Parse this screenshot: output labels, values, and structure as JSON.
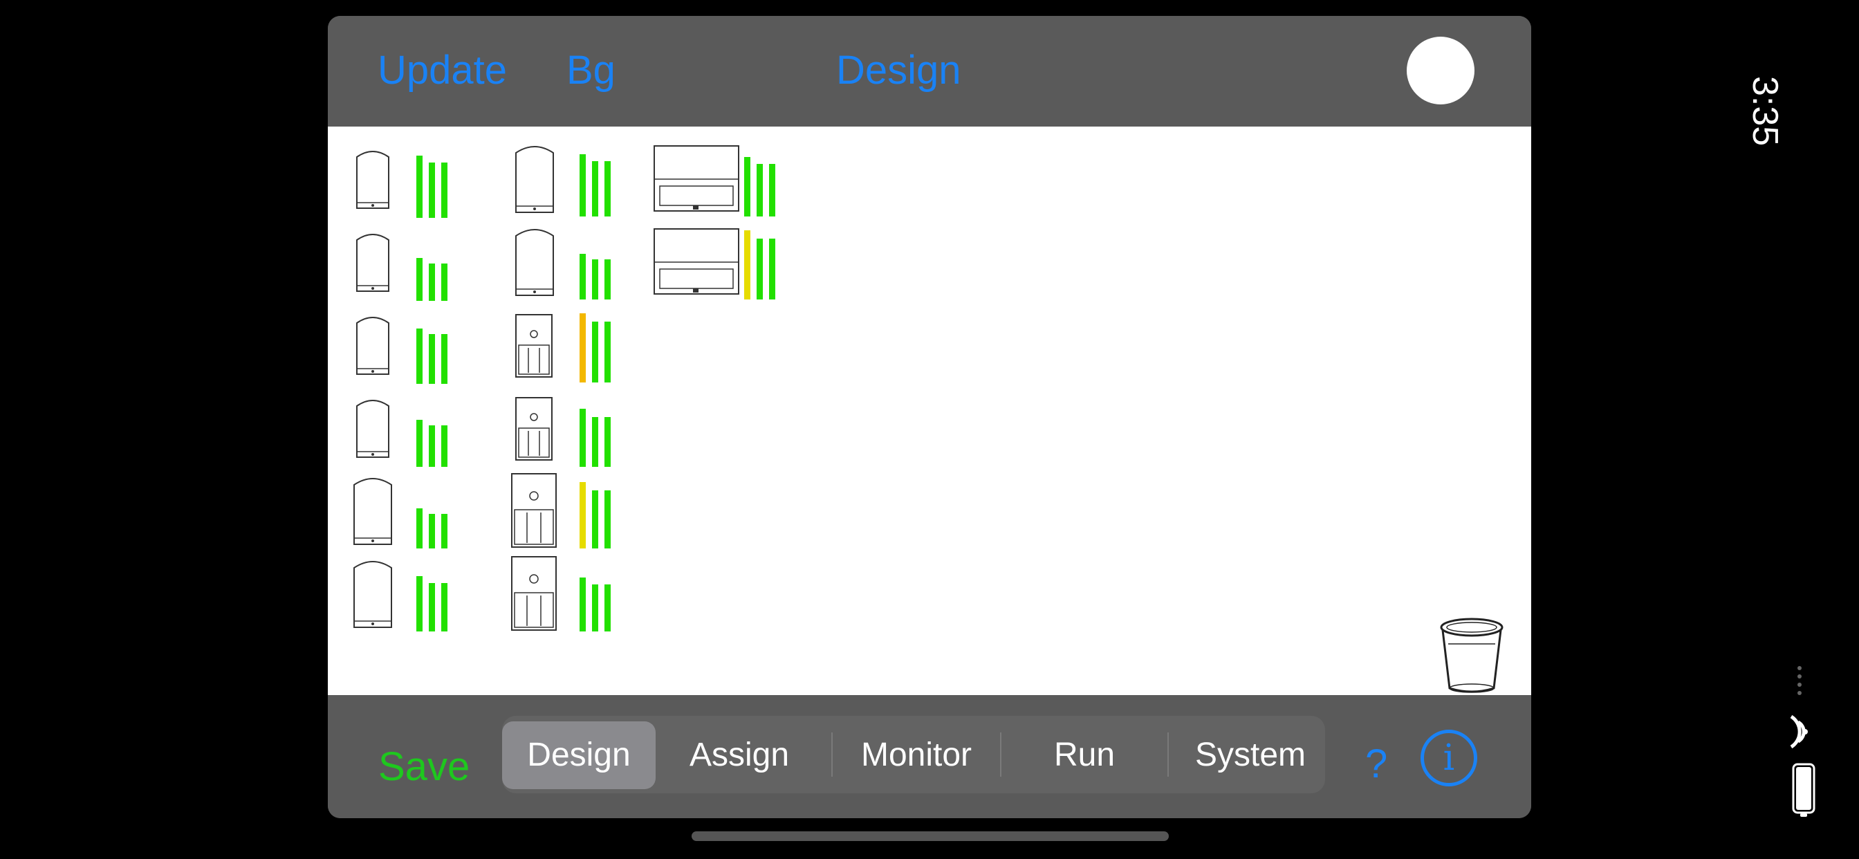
{
  "clock": "3:35",
  "topbar": {
    "update_label": "Update",
    "bg_label": "Bg",
    "title": "Design"
  },
  "bottombar": {
    "save_label": "Save",
    "tabs": [
      {
        "label": "Design",
        "active": true
      },
      {
        "label": "Assign",
        "active": false
      },
      {
        "label": "Monitor",
        "active": false
      },
      {
        "label": "Run",
        "active": false
      },
      {
        "label": "System",
        "active": false
      }
    ],
    "help_label": "?",
    "info_label": "i"
  },
  "colors": {
    "accent": "#1a82f5",
    "save": "#1ec81e",
    "meter_green": "#22e000",
    "meter_yellow": "#e6dc00",
    "meter_orange": "#f3b800"
  }
}
